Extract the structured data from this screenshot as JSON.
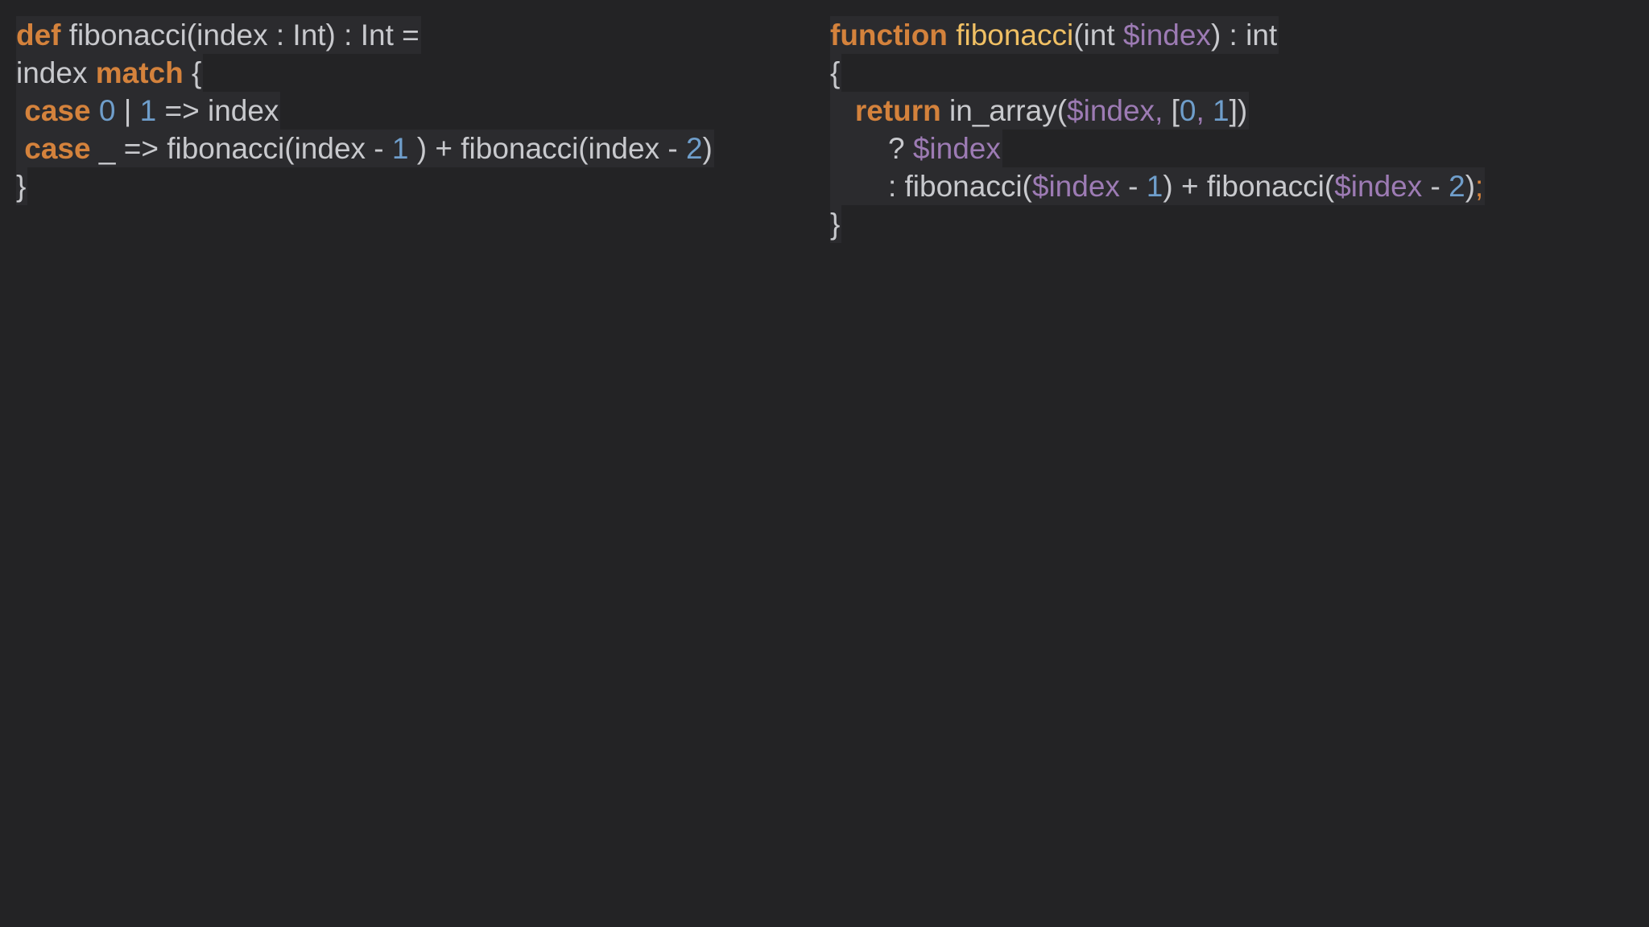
{
  "scala_code": {
    "lines": [
      [
        {
          "t": "def",
          "c": "kw"
        },
        {
          "t": " fibonacci(index : Int) : Int =",
          "c": "plain"
        }
      ],
      [
        {
          "t": "index ",
          "c": "plain"
        },
        {
          "t": "match",
          "c": "kw"
        },
        {
          "t": " {",
          "c": "plain"
        }
      ],
      [
        {
          "t": " ",
          "c": "plain"
        },
        {
          "t": "case",
          "c": "kw"
        },
        {
          "t": " ",
          "c": "plain"
        },
        {
          "t": "0",
          "c": "num"
        },
        {
          "t": " | ",
          "c": "plain"
        },
        {
          "t": "1",
          "c": "num"
        },
        {
          "t": " => index",
          "c": "plain"
        }
      ],
      [
        {
          "t": " ",
          "c": "plain"
        },
        {
          "t": "case",
          "c": "kw"
        },
        {
          "t": " _ => fibonacci(index - ",
          "c": "plain"
        },
        {
          "t": "1",
          "c": "num"
        },
        {
          "t": " ) + fibonacci(index - ",
          "c": "plain"
        },
        {
          "t": "2",
          "c": "num"
        },
        {
          "t": ")",
          "c": "plain"
        }
      ],
      [
        {
          "t": "}",
          "c": "plain"
        }
      ]
    ]
  },
  "php_code": {
    "lines": [
      [
        {
          "t": "function",
          "c": "kw"
        },
        {
          "t": " ",
          "c": "plain"
        },
        {
          "t": "fibonacci",
          "c": "fn"
        },
        {
          "t": "(int ",
          "c": "plain"
        },
        {
          "t": "$index",
          "c": "var"
        },
        {
          "t": ") : int",
          "c": "plain"
        }
      ],
      [
        {
          "t": "{",
          "c": "plain"
        }
      ],
      [
        {
          "t": "   ",
          "c": "plain"
        },
        {
          "t": "return",
          "c": "kw"
        },
        {
          "t": " in_array(",
          "c": "plain"
        },
        {
          "t": "$index",
          "c": "var"
        },
        {
          "t": ", ",
          "c": "var"
        },
        {
          "t": "[",
          "c": "plain"
        },
        {
          "t": "0",
          "c": "num"
        },
        {
          "t": ", ",
          "c": "var"
        },
        {
          "t": "1",
          "c": "num"
        },
        {
          "t": "])",
          "c": "plain"
        }
      ],
      [
        {
          "t": "       ? ",
          "c": "plain"
        },
        {
          "t": "$index",
          "c": "var"
        }
      ],
      [
        {
          "t": "       : fibonacci(",
          "c": "plain"
        },
        {
          "t": "$index",
          "c": "var"
        },
        {
          "t": " - ",
          "c": "plain"
        },
        {
          "t": "1",
          "c": "num"
        },
        {
          "t": ") + fibonacci(",
          "c": "plain"
        },
        {
          "t": "$index",
          "c": "var"
        },
        {
          "t": " - ",
          "c": "plain"
        },
        {
          "t": "2",
          "c": "num"
        },
        {
          "t": ")",
          "c": "plain"
        },
        {
          "t": ";",
          "c": "semi"
        }
      ],
      [
        {
          "t": "}",
          "c": "plain"
        }
      ]
    ]
  },
  "colors": {
    "background": "#232325",
    "keyword": "#d4823c",
    "function_name": "#f0c064",
    "number": "#6f9ecb",
    "variable": "#9d7bb4",
    "plain_text": "#c8c9cd"
  }
}
